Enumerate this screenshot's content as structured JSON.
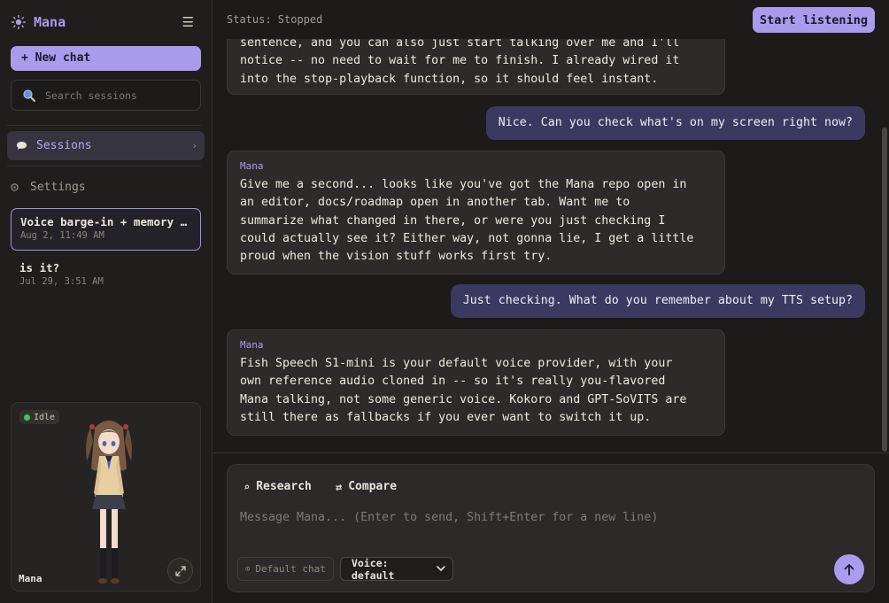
{
  "sidebar": {
    "brand": "Mana",
    "new_chat": "+ New chat",
    "search_placeholder": "Search sessions",
    "nav_sessions": "Sessions",
    "nav_settings": "Settings",
    "sessions": [
      {
        "title": "Voice barge-in + memory …",
        "time": "Aug 2, 11:49 AM",
        "active": true
      },
      {
        "title": "is it?",
        "time": "Jul 29, 3:51 AM",
        "active": false
      }
    ],
    "avatar": {
      "status": "Idle",
      "name": "Mana"
    }
  },
  "topbar": {
    "status": "Status: Stopped",
    "start_button": "Start listening"
  },
  "messages": [
    {
      "role": "assistant",
      "name": "",
      "text": "sentence, and you can also just start talking over me and I'll\nnotice -- no need to wait for me to finish. I already wired it\ninto the stop-playback function, so it should feel instant."
    },
    {
      "role": "user",
      "text": "Nice. Can you check what's on my screen right now?"
    },
    {
      "role": "assistant",
      "name": "Mana",
      "text": "Give me a second... looks like you've got the Mana repo open in\nan editor, docs/roadmap open in another tab. Want me to\nsummarize what changed in there, or were you just checking I\ncould actually see it? Either way, not gonna lie, I get a little\nproud when the vision stuff works first try."
    },
    {
      "role": "user",
      "text": "Just checking. What do you remember about my TTS setup?"
    },
    {
      "role": "assistant",
      "name": "Mana",
      "text": "Fish Speech S1-mini is your default voice provider, with your\nown reference audio cloned in -- so it's really you-flavored\nMana talking, not some generic voice. Kokoro and GPT-SoVITS are\nstill there as fallbacks if you ever want to switch it up."
    }
  ],
  "composer": {
    "research": "Research",
    "compare": "Compare",
    "placeholder": "Message Mana... (Enter to send, Shift+Enter for a new line)",
    "chat_mode": "Default chat",
    "voice": "Voice: default"
  },
  "colors": {
    "accent": "#a99cec",
    "user_bubble": "#3b3960",
    "status_idle": "#3ec46d"
  }
}
